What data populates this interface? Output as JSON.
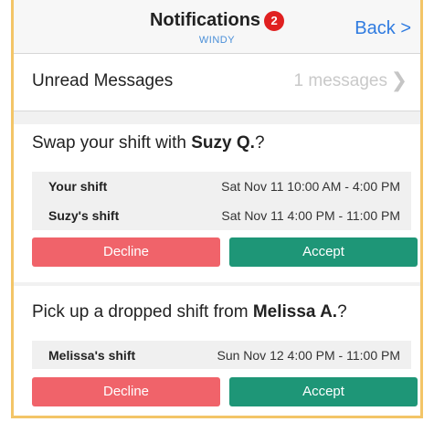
{
  "header": {
    "title": "Notifications",
    "badge_count": "2",
    "subtitle": "WINDY",
    "back_label": "Back >"
  },
  "unread": {
    "label": "Unread Messages",
    "count_text": "1 messages",
    "chevron": "❯"
  },
  "notifications": [
    {
      "question_prefix": "Swap your shift with ",
      "question_name": "Suzy Q.",
      "question_suffix": "?",
      "shifts": [
        {
          "name": "Your shift",
          "time": "Sat Nov 11 10:00 AM - 4:00 PM"
        },
        {
          "name": "Suzy's shift",
          "time": "Sat Nov 11 4:00 PM - 11:00 PM"
        }
      ],
      "decline_label": "Decline",
      "accept_label": "Accept"
    },
    {
      "question_prefix": "Pick up a dropped shift from ",
      "question_name": "Melissa A.",
      "question_suffix": "?",
      "shifts": [
        {
          "name": "Melissa's shift",
          "time": "Sun Nov 12 4:00 PM - 11:00 PM"
        }
      ],
      "decline_label": "Decline",
      "accept_label": "Accept"
    }
  ],
  "colors": {
    "decline": "#f0636a",
    "accept": "#1e9677",
    "link": "#2f7be0",
    "badge": "#e02020",
    "frame": "#f3c567"
  }
}
